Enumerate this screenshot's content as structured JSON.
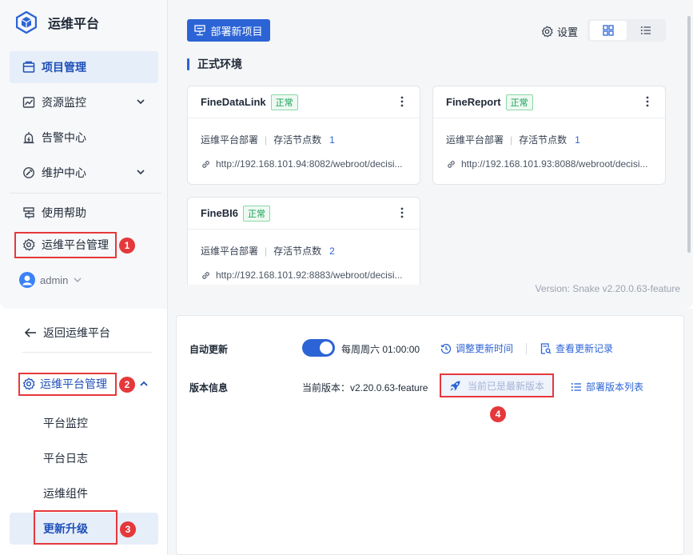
{
  "top": {
    "brand": {
      "title": "运维平台"
    },
    "nav": [
      {
        "label": "项目管理",
        "icon": "project-icon",
        "active": true
      },
      {
        "label": "资源监控",
        "icon": "chart-icon",
        "expandable": true
      },
      {
        "label": "告警中心",
        "icon": "alarm-icon"
      },
      {
        "label": "维护中心",
        "icon": "maintenance-icon",
        "expandable": true
      },
      {
        "label": "使用帮助",
        "icon": "help-icon"
      },
      {
        "label": "运维平台管理",
        "icon": "gear-icon"
      }
    ],
    "user": {
      "name": "admin"
    },
    "toolbar": {
      "deploy_label": "部署新项目",
      "settings_label": "设置"
    },
    "section_title": "正式环境",
    "cards": [
      {
        "name": "FineDataLink",
        "status": "正常",
        "deploy_label": "运维平台部署",
        "nodes_label": "存活节点数",
        "nodes": "1",
        "url": "http://192.168.101.94:8082/webroot/decisi..."
      },
      {
        "name": "FineReport",
        "status": "正常",
        "deploy_label": "运维平台部署",
        "nodes_label": "存活节点数",
        "nodes": "1",
        "url": "http://192.168.101.93:8088/webroot/decisi..."
      },
      {
        "name": "FineBI6",
        "status": "正常",
        "deploy_label": "运维平台部署",
        "nodes_label": "存活节点数",
        "nodes": "2",
        "url": "http://192.168.101.92:8883/webroot/decisi..."
      }
    ],
    "version": "Version: Snake v2.20.0.63-feature"
  },
  "bottom": {
    "back_label": "返回运维平台",
    "group_label": "运维平台管理",
    "sub_items": [
      "平台监控",
      "平台日志",
      "运维组件",
      "更新升级"
    ],
    "auto_update": {
      "label": "自动更新",
      "enabled": true,
      "schedule": "每周周六 01:00:00",
      "adjust_label": "调整更新时间",
      "history_label": "查看更新记录"
    },
    "version_info": {
      "label": "版本信息",
      "current": "当前版本：v2.20.0.63-feature",
      "latest_label": "当前已是最新版本",
      "list_label": "部署版本列表"
    }
  },
  "badges": [
    "1",
    "2",
    "3",
    "4"
  ],
  "colors": {
    "accent": "#2c64d6",
    "highlight": "#e5383b",
    "status_ok": "#18a058"
  }
}
